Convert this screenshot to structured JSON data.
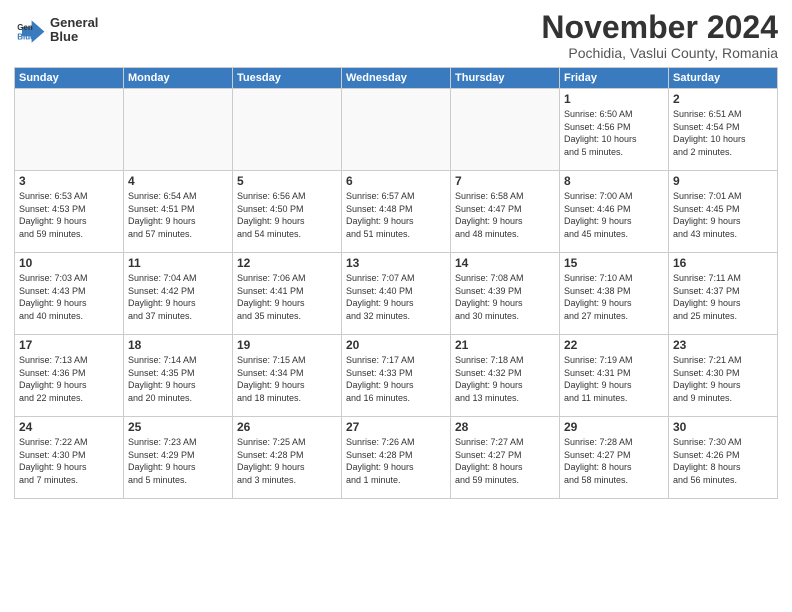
{
  "logo": {
    "line1": "General",
    "line2": "Blue"
  },
  "title": "November 2024",
  "subtitle": "Pochidia, Vaslui County, Romania",
  "days_of_week": [
    "Sunday",
    "Monday",
    "Tuesday",
    "Wednesday",
    "Thursday",
    "Friday",
    "Saturday"
  ],
  "weeks": [
    [
      {
        "day": "",
        "info": ""
      },
      {
        "day": "",
        "info": ""
      },
      {
        "day": "",
        "info": ""
      },
      {
        "day": "",
        "info": ""
      },
      {
        "day": "",
        "info": ""
      },
      {
        "day": "1",
        "info": "Sunrise: 6:50 AM\nSunset: 4:56 PM\nDaylight: 10 hours\nand 5 minutes."
      },
      {
        "day": "2",
        "info": "Sunrise: 6:51 AM\nSunset: 4:54 PM\nDaylight: 10 hours\nand 2 minutes."
      }
    ],
    [
      {
        "day": "3",
        "info": "Sunrise: 6:53 AM\nSunset: 4:53 PM\nDaylight: 9 hours\nand 59 minutes."
      },
      {
        "day": "4",
        "info": "Sunrise: 6:54 AM\nSunset: 4:51 PM\nDaylight: 9 hours\nand 57 minutes."
      },
      {
        "day": "5",
        "info": "Sunrise: 6:56 AM\nSunset: 4:50 PM\nDaylight: 9 hours\nand 54 minutes."
      },
      {
        "day": "6",
        "info": "Sunrise: 6:57 AM\nSunset: 4:48 PM\nDaylight: 9 hours\nand 51 minutes."
      },
      {
        "day": "7",
        "info": "Sunrise: 6:58 AM\nSunset: 4:47 PM\nDaylight: 9 hours\nand 48 minutes."
      },
      {
        "day": "8",
        "info": "Sunrise: 7:00 AM\nSunset: 4:46 PM\nDaylight: 9 hours\nand 45 minutes."
      },
      {
        "day": "9",
        "info": "Sunrise: 7:01 AM\nSunset: 4:45 PM\nDaylight: 9 hours\nand 43 minutes."
      }
    ],
    [
      {
        "day": "10",
        "info": "Sunrise: 7:03 AM\nSunset: 4:43 PM\nDaylight: 9 hours\nand 40 minutes."
      },
      {
        "day": "11",
        "info": "Sunrise: 7:04 AM\nSunset: 4:42 PM\nDaylight: 9 hours\nand 37 minutes."
      },
      {
        "day": "12",
        "info": "Sunrise: 7:06 AM\nSunset: 4:41 PM\nDaylight: 9 hours\nand 35 minutes."
      },
      {
        "day": "13",
        "info": "Sunrise: 7:07 AM\nSunset: 4:40 PM\nDaylight: 9 hours\nand 32 minutes."
      },
      {
        "day": "14",
        "info": "Sunrise: 7:08 AM\nSunset: 4:39 PM\nDaylight: 9 hours\nand 30 minutes."
      },
      {
        "day": "15",
        "info": "Sunrise: 7:10 AM\nSunset: 4:38 PM\nDaylight: 9 hours\nand 27 minutes."
      },
      {
        "day": "16",
        "info": "Sunrise: 7:11 AM\nSunset: 4:37 PM\nDaylight: 9 hours\nand 25 minutes."
      }
    ],
    [
      {
        "day": "17",
        "info": "Sunrise: 7:13 AM\nSunset: 4:36 PM\nDaylight: 9 hours\nand 22 minutes."
      },
      {
        "day": "18",
        "info": "Sunrise: 7:14 AM\nSunset: 4:35 PM\nDaylight: 9 hours\nand 20 minutes."
      },
      {
        "day": "19",
        "info": "Sunrise: 7:15 AM\nSunset: 4:34 PM\nDaylight: 9 hours\nand 18 minutes."
      },
      {
        "day": "20",
        "info": "Sunrise: 7:17 AM\nSunset: 4:33 PM\nDaylight: 9 hours\nand 16 minutes."
      },
      {
        "day": "21",
        "info": "Sunrise: 7:18 AM\nSunset: 4:32 PM\nDaylight: 9 hours\nand 13 minutes."
      },
      {
        "day": "22",
        "info": "Sunrise: 7:19 AM\nSunset: 4:31 PM\nDaylight: 9 hours\nand 11 minutes."
      },
      {
        "day": "23",
        "info": "Sunrise: 7:21 AM\nSunset: 4:30 PM\nDaylight: 9 hours\nand 9 minutes."
      }
    ],
    [
      {
        "day": "24",
        "info": "Sunrise: 7:22 AM\nSunset: 4:30 PM\nDaylight: 9 hours\nand 7 minutes."
      },
      {
        "day": "25",
        "info": "Sunrise: 7:23 AM\nSunset: 4:29 PM\nDaylight: 9 hours\nand 5 minutes."
      },
      {
        "day": "26",
        "info": "Sunrise: 7:25 AM\nSunset: 4:28 PM\nDaylight: 9 hours\nand 3 minutes."
      },
      {
        "day": "27",
        "info": "Sunrise: 7:26 AM\nSunset: 4:28 PM\nDaylight: 9 hours\nand 1 minute."
      },
      {
        "day": "28",
        "info": "Sunrise: 7:27 AM\nSunset: 4:27 PM\nDaylight: 8 hours\nand 59 minutes."
      },
      {
        "day": "29",
        "info": "Sunrise: 7:28 AM\nSunset: 4:27 PM\nDaylight: 8 hours\nand 58 minutes."
      },
      {
        "day": "30",
        "info": "Sunrise: 7:30 AM\nSunset: 4:26 PM\nDaylight: 8 hours\nand 56 minutes."
      }
    ]
  ]
}
